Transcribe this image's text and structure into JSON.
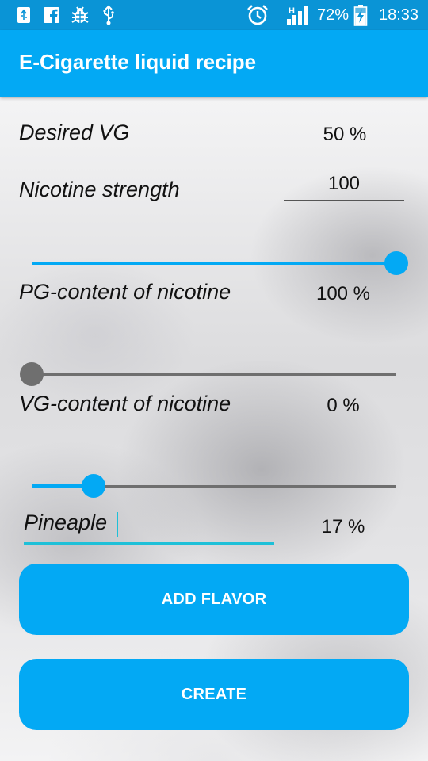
{
  "status_bar": {
    "battery_percent": "72%",
    "time": "18:33",
    "network_type": "H",
    "icons": [
      "usb-icon",
      "facebook-icon",
      "bug-icon",
      "usb-symbol-icon",
      "alarm-icon",
      "signal-icon",
      "battery-charging-icon"
    ]
  },
  "app_bar": {
    "title": "E-Cigarette liquid recipe"
  },
  "form": {
    "desired_vg": {
      "label": "Desired VG",
      "value": "50 %"
    },
    "nicotine_strength": {
      "label": "Nicotine strength",
      "value": "100"
    },
    "pg_content": {
      "label": "PG-content of nicotine",
      "value": "100 %",
      "slider_fraction": 1.0
    },
    "vg_content": {
      "label": "VG-content of nicotine",
      "value": "0 %",
      "slider_fraction": 0.0
    },
    "flavor": {
      "name": "Pineaple",
      "value": "17 %",
      "slider_fraction": 0.17
    }
  },
  "buttons": {
    "add_flavor": "ADD FLAVOR",
    "create": "CREATE"
  },
  "colors": {
    "accent": "#03a9f4",
    "status_bar": "#0a94d6",
    "inactive_thumb": "#6f6f6f",
    "cursor": "#1ec0d8"
  }
}
